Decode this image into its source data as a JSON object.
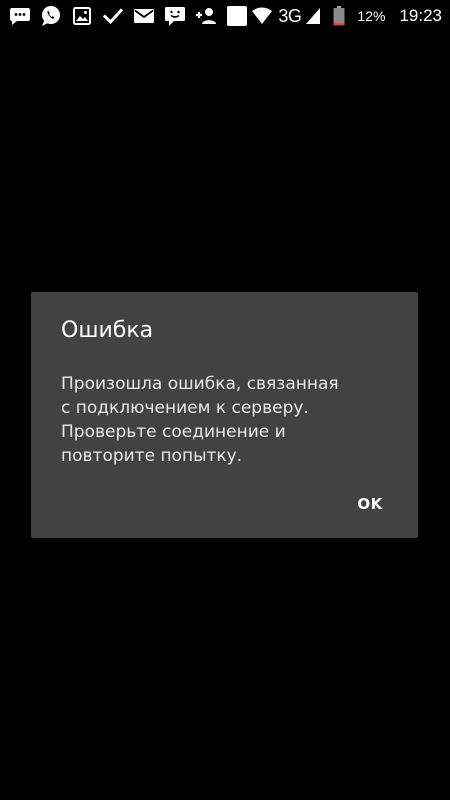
{
  "status_bar": {
    "notification_icons": [
      "messenger-icon",
      "viber-icon",
      "gallery-icon",
      "check-icon",
      "mail-icon",
      "chat-icon",
      "add-contact-icon",
      "blank-app-icon"
    ],
    "network_type": "3G",
    "battery_percent": "12%",
    "time": "19:23",
    "battery_level": 0.12,
    "battery_color": "#e53935"
  },
  "dialog": {
    "title": "Ошибка",
    "message": "Произошла ошибка, связанная\nс подключением к серверу.\nПроверьте соединение и\nповторите попытку.",
    "ok_label": "OK"
  },
  "colors": {
    "background": "#000000",
    "dialog_background": "#424242",
    "text_primary": "#ffffff"
  }
}
